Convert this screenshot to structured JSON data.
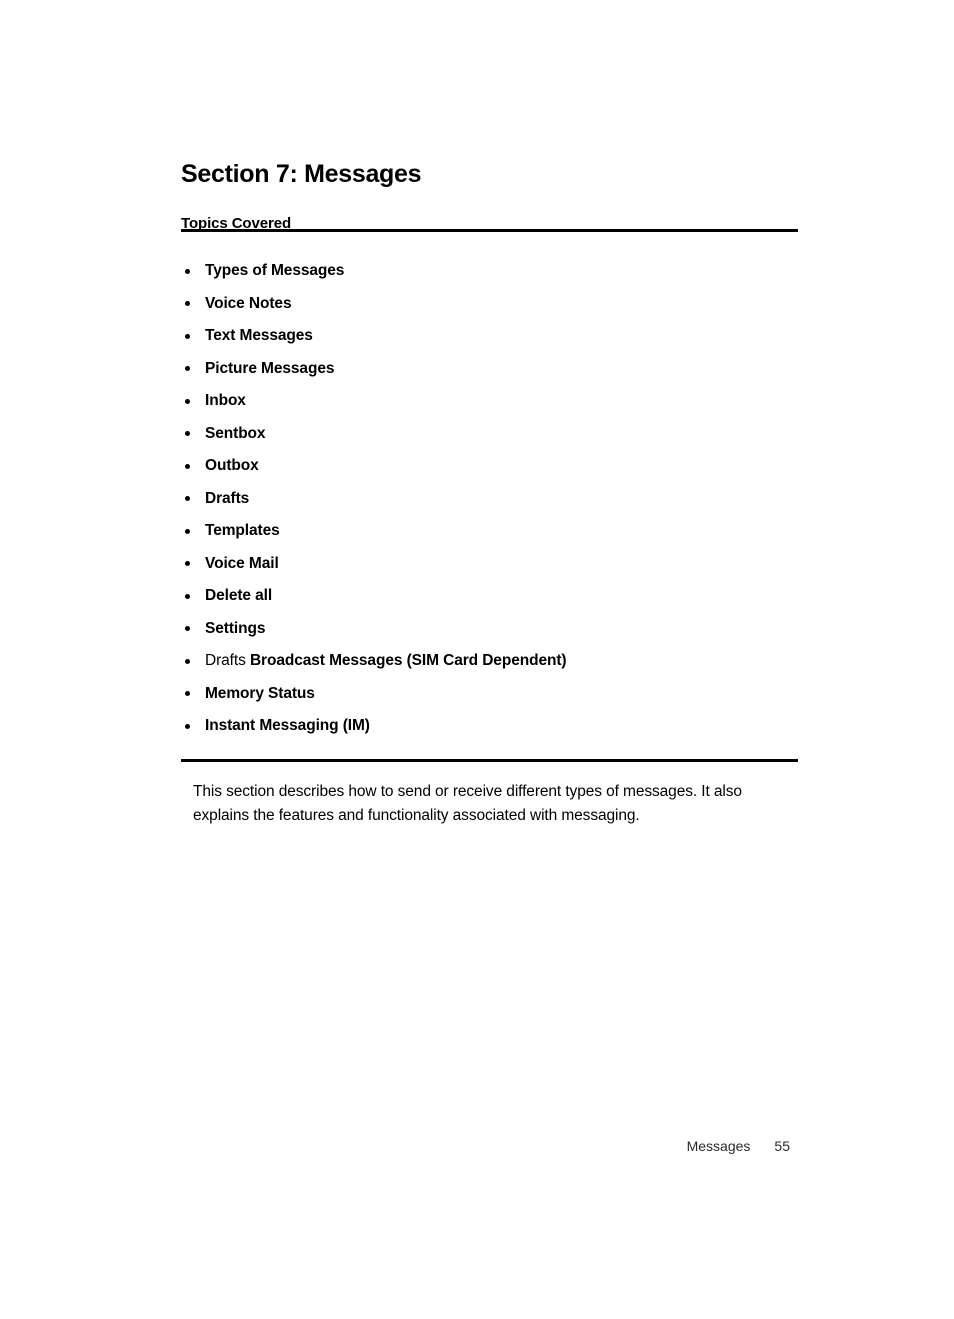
{
  "document": {
    "section_title": "Section 7: Messages",
    "topics_heading": "Topics Covered",
    "topics": [
      {
        "label": "Types of Messages"
      },
      {
        "label": "Voice Notes"
      },
      {
        "label": "Text Messages"
      },
      {
        "label": "Picture Messages"
      },
      {
        "label": "Inbox"
      },
      {
        "label": "Sentbox"
      },
      {
        "label": "Outbox"
      },
      {
        "label": "Drafts"
      },
      {
        "label": "Templates"
      },
      {
        "label": "Voice Mail"
      },
      {
        "label": "Delete all"
      },
      {
        "label": "Settings"
      },
      {
        "label_light": "Drafts ",
        "label": "Broadcast Messages (SIM Card Dependent)"
      },
      {
        "label": "Memory Status"
      },
      {
        "label": "Instant Messaging (IM)"
      }
    ],
    "intro_paragraph": "This section describes how to send or receive different types of messages. It also explains the features and functionality associated with messaging.",
    "footer": {
      "label": "Messages",
      "page_number": "55"
    }
  }
}
